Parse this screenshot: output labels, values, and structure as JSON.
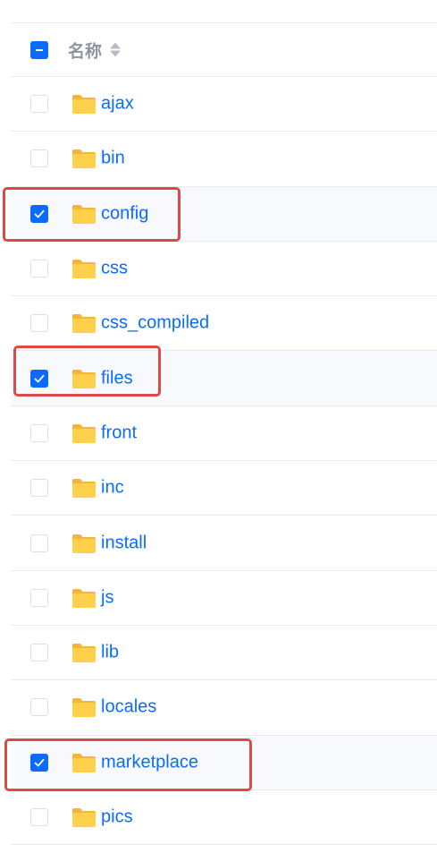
{
  "header": {
    "column_name": "名称"
  },
  "files": [
    {
      "name": "ajax",
      "checked": false
    },
    {
      "name": "bin",
      "checked": false
    },
    {
      "name": "config",
      "checked": true
    },
    {
      "name": "css",
      "checked": false
    },
    {
      "name": "css_compiled",
      "checked": false
    },
    {
      "name": "files",
      "checked": true
    },
    {
      "name": "front",
      "checked": false
    },
    {
      "name": "inc",
      "checked": false
    },
    {
      "name": "install",
      "checked": false
    },
    {
      "name": "js",
      "checked": false
    },
    {
      "name": "lib",
      "checked": false
    },
    {
      "name": "locales",
      "checked": false
    },
    {
      "name": "marketplace",
      "checked": true
    },
    {
      "name": "pics",
      "checked": false
    }
  ],
  "colors": {
    "accent": "#0a6cff",
    "folder": "#ffd04a",
    "folder_tab": "#f6b43b",
    "highlight": "#e04848"
  }
}
